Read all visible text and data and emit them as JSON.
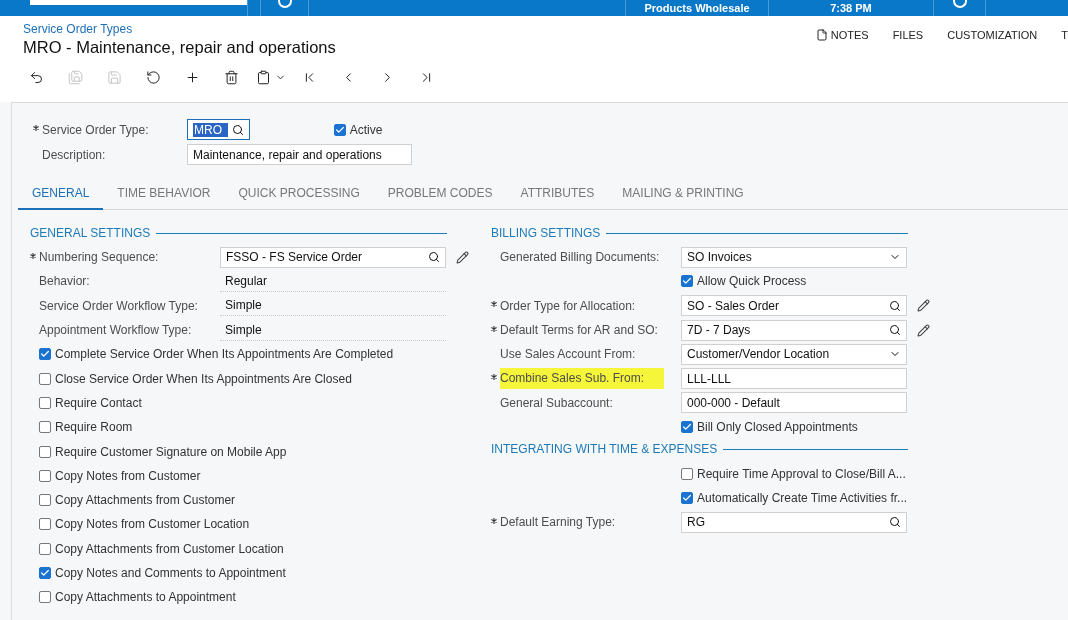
{
  "top_bar": {
    "company": "Products Wholesale",
    "time": "7:38 PM"
  },
  "header": {
    "breadcrumb": "Service Order Types",
    "title": "MRO - Maintenance, repair and operations",
    "actions": [
      {
        "label": "NOTES",
        "kind": "notes"
      },
      {
        "label": "FILES",
        "kind": "plain"
      },
      {
        "label": "CUSTOMIZATION",
        "kind": "plain"
      },
      {
        "label": "T",
        "kind": "plain"
      }
    ]
  },
  "toolbar": [
    {
      "kind": "back",
      "disabled": false
    },
    {
      "kind": "save-close",
      "disabled": true
    },
    {
      "kind": "save",
      "disabled": true
    },
    {
      "kind": "undo",
      "disabled": false
    },
    {
      "kind": "add",
      "disabled": false
    },
    {
      "kind": "delete",
      "disabled": false
    },
    {
      "kind": "copy",
      "disabled": false
    },
    {
      "kind": "first",
      "disabled": false
    },
    {
      "kind": "prev",
      "disabled": false
    },
    {
      "kind": "next",
      "disabled": false
    },
    {
      "kind": "last",
      "disabled": false
    }
  ],
  "form": {
    "type_required": true,
    "type_label": "Service Order Type:",
    "type_value": "MRO",
    "active": {
      "label": "Active",
      "checked": true
    },
    "description_label": "Description:",
    "description_value": "Maintenance, repair and operations"
  },
  "tabs": [
    {
      "label": "GENERAL",
      "selected": true
    },
    {
      "label": "TIME BEHAVIOR",
      "selected": false
    },
    {
      "label": "QUICK PROCESSING",
      "selected": false
    },
    {
      "label": "PROBLEM CODES",
      "selected": false
    },
    {
      "label": "ATTRIBUTES",
      "selected": false
    },
    {
      "label": "MAILING & PRINTING",
      "selected": false
    }
  ],
  "columns": [
    [
      {
        "title": "GENERAL SETTINGS",
        "rows": [
          {
            "kind": "lookup",
            "label": "Numbering Sequence:",
            "value": "FSSO - FS Service Order",
            "required": true,
            "editable": true,
            "highlighted": false
          },
          {
            "kind": "static",
            "label": "Behavior:",
            "value": "Regular",
            "required": false,
            "highlighted": false
          },
          {
            "kind": "static",
            "label": "Service Order Workflow Type:",
            "value": "Simple",
            "required": false,
            "highlighted": false
          },
          {
            "kind": "static",
            "label": "Appointment Workflow Type:",
            "value": "Simple",
            "required": false,
            "highlighted": false
          },
          {
            "kind": "checkbox",
            "label": "Complete Service Order When Its Appointments Are Completed",
            "checked": true
          },
          {
            "kind": "checkbox",
            "label": "Close Service Order When Its Appointments Are Closed",
            "checked": false
          },
          {
            "kind": "checkbox",
            "label": "Require Contact",
            "checked": false
          },
          {
            "kind": "checkbox",
            "label": "Require Room",
            "checked": false
          },
          {
            "kind": "checkbox",
            "label": "Require Customer Signature on Mobile App",
            "checked": false
          },
          {
            "kind": "checkbox",
            "label": "Copy Notes from Customer",
            "checked": false
          },
          {
            "kind": "checkbox",
            "label": "Copy Attachments from Customer",
            "checked": false
          },
          {
            "kind": "checkbox",
            "label": "Copy Notes from Customer Location",
            "checked": false
          },
          {
            "kind": "checkbox",
            "label": "Copy Attachments from Customer Location",
            "checked": false
          },
          {
            "kind": "checkbox",
            "label": "Copy Notes and Comments to Appointment",
            "checked": true
          },
          {
            "kind": "checkbox",
            "label": "Copy Attachments to Appointment",
            "checked": false
          }
        ]
      }
    ],
    [
      {
        "title": "BILLING SETTINGS",
        "rows": [
          {
            "kind": "select",
            "label": "Generated Billing Documents:",
            "value": "SO Invoices",
            "required": false,
            "highlighted": false
          },
          {
            "kind": "checkbox",
            "label": "Allow Quick Process",
            "checked": true
          },
          {
            "kind": "lookup",
            "label": "Order Type for Allocation:",
            "value": "SO - Sales Order",
            "required": true,
            "editable": true,
            "highlighted": false
          },
          {
            "kind": "lookup",
            "label": "Default Terms for AR and SO:",
            "value": "7D - 7 Days",
            "required": true,
            "editable": true,
            "highlighted": false
          },
          {
            "kind": "select",
            "label": "Use Sales Account From:",
            "value": "Customer/Vendor Location",
            "required": false,
            "highlighted": false
          },
          {
            "kind": "text",
            "label": "Combine Sales Sub. From:",
            "value": "LLL-LLL",
            "required": true,
            "highlighted": true
          },
          {
            "kind": "text",
            "label": "General Subaccount:",
            "value": "000-000 - Default",
            "required": false,
            "highlighted": false
          },
          {
            "kind": "checkbox",
            "label": "Bill Only Closed Appointments",
            "checked": true
          }
        ]
      },
      {
        "title": "INTEGRATING WITH TIME & EXPENSES",
        "rows": [
          {
            "kind": "checkbox",
            "label": "Require Time Approval to Close/Bill A...",
            "checked": false
          },
          {
            "kind": "checkbox",
            "label": "Automatically Create Time Activities fr...",
            "checked": true
          },
          {
            "kind": "lookup",
            "label": "Default Earning Type:",
            "value": "RG",
            "required": true,
            "editable": false,
            "highlighted": false
          }
        ]
      }
    ]
  ]
}
